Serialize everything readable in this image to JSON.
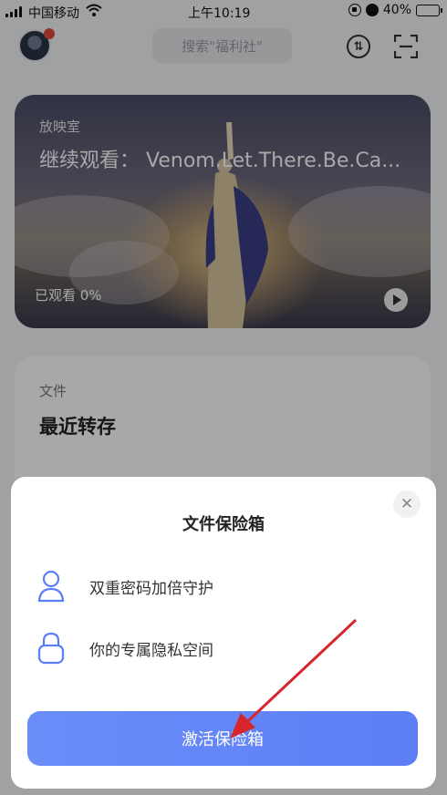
{
  "status_bar": {
    "carrier": "中国移动",
    "time": "上午10:19",
    "battery": "40%",
    "battery_level": 0.4
  },
  "header": {
    "search_placeholder": "搜索\"福利社\""
  },
  "video_card": {
    "kicker": "放映室",
    "title": "继续观看：  Venom.Let.There.Be.Ca...",
    "progress": "已观看 0%"
  },
  "file_card": {
    "kicker": "文件",
    "title": "最近转存"
  },
  "modal": {
    "title": "文件保险箱",
    "features": [
      {
        "icon": "user-icon",
        "label": "双重密码加倍守护"
      },
      {
        "icon": "lock-icon",
        "label": "你的专属隐私空间"
      }
    ],
    "button_label": "激活保险箱",
    "close_symbol": "✕"
  },
  "colors": {
    "accent": "#5d7ef5",
    "annotation": "#d6262b"
  }
}
